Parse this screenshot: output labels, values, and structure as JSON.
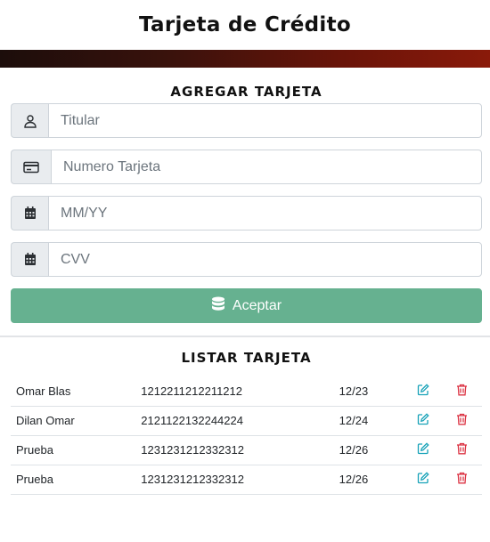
{
  "header": {
    "title": "Tarjeta de Crédito"
  },
  "form": {
    "title": "AGREGAR TARJETA",
    "titular_placeholder": "Titular",
    "numero_placeholder": "Numero Tarjeta",
    "expiry_placeholder": "MM/YY",
    "cvv_placeholder": "CVV",
    "submit_label": "Aceptar"
  },
  "list": {
    "title": "LISTAR TARJETA",
    "rows": [
      {
        "name": "Omar Blas",
        "number": "1212211212211212",
        "expiry": "12/23"
      },
      {
        "name": "Dilan Omar",
        "number": "2121122132244224",
        "expiry": "12/24"
      },
      {
        "name": "Prueba",
        "number": "1231231212332312",
        "expiry": "12/26"
      },
      {
        "name": "Prueba",
        "number": "1231231212332312",
        "expiry": "12/26"
      }
    ]
  },
  "colors": {
    "accent_gradient_start": "#1c0d0b",
    "accent_gradient_end": "#8a1a0a",
    "submit_button": "#66b190",
    "edit_icon": "#17a2b8",
    "delete_icon": "#dc3545"
  },
  "icons": {
    "titular": "user-icon",
    "numero": "credit-card-icon",
    "expiry": "calendar-icon",
    "cvv": "calendar-icon",
    "submit": "database-icon",
    "edit": "edit-icon",
    "delete": "trash-icon"
  }
}
